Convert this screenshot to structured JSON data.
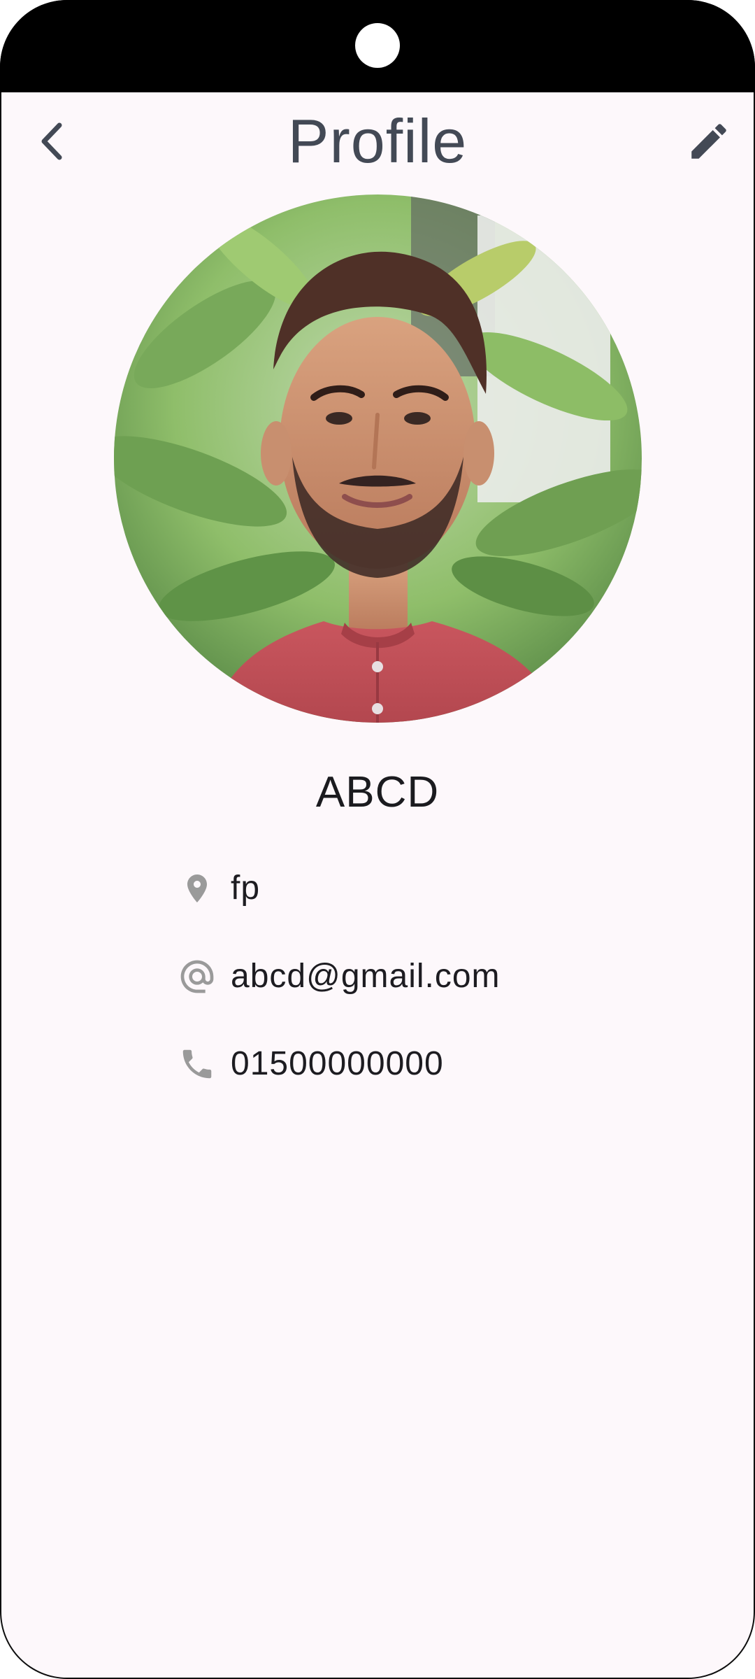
{
  "header": {
    "title": "Profile",
    "back_icon": "chevron-left-icon",
    "edit_icon": "pencil-icon"
  },
  "profile": {
    "name": "ABCD",
    "location": "fp",
    "email": "abcd@gmail.com",
    "phone": "01500000000",
    "photo_icon": "profile-photo"
  },
  "colors": {
    "background": "#fdf8fb",
    "title_text": "#434955",
    "body_text": "#1d1c21",
    "icon_gray": "#9a9a9a",
    "status_bar": "#000000"
  }
}
